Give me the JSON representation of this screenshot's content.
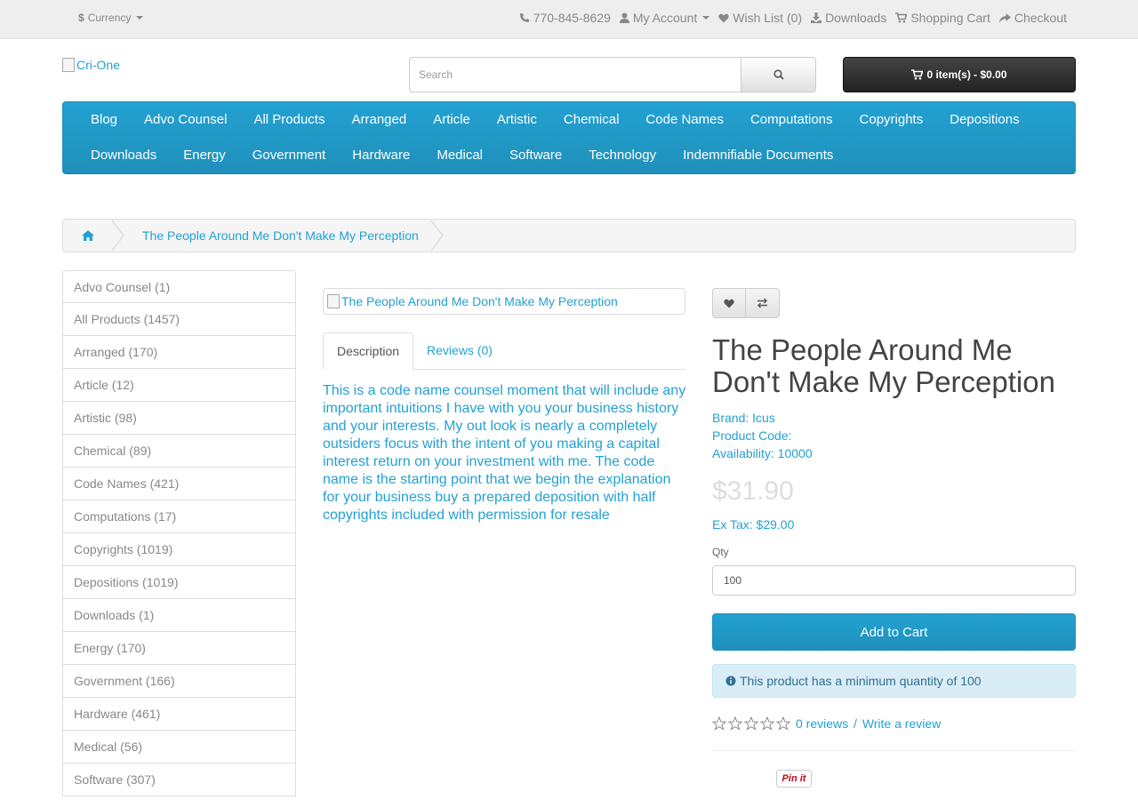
{
  "topbar": {
    "currency": "Currency",
    "phone": "770-845-8629",
    "my_account": "My Account",
    "wish_list": "Wish List (0)",
    "downloads": "Downloads",
    "shopping_cart": "Shopping Cart",
    "checkout": "Checkout"
  },
  "header": {
    "logo_alt": "Cri-One",
    "search_placeholder": "Search",
    "cart_label": "0 item(s) - $0.00"
  },
  "menu": {
    "items": [
      "Blog",
      "Advo Counsel",
      "All Products",
      "Arranged",
      "Article",
      "Artistic",
      "Chemical",
      "Code Names",
      "Computations",
      "Copyrights",
      "Depositions",
      "Downloads",
      "Energy",
      "Government",
      "Hardware",
      "Medical",
      "Software",
      "Technology",
      "Indemnifiable Documents"
    ]
  },
  "breadcrumb": {
    "current": "The People Around Me Don't Make My Perception"
  },
  "sidebar": {
    "items": [
      "Advo Counsel (1)",
      "All Products (1457)",
      "Arranged (170)",
      "Article (12)",
      "Artistic (98)",
      "Chemical (89)",
      "Code Names (421)",
      "Computations (17)",
      "Copyrights (1019)",
      "Depositions (1019)",
      "Downloads (1)",
      "Energy (170)",
      "Government (166)",
      "Hardware (461)",
      "Medical (56)",
      "Software (307)"
    ]
  },
  "product": {
    "image_alt": "The People Around Me Don't Make My Perception",
    "tab_description": "Description",
    "tab_reviews": "Reviews (0)",
    "description": "This is a code name counsel moment that will include any important intuitions I have with you your business history and your interests. My out look is nearly a completely outsiders focus with the intent of you making a capital interest return on your investment with me. The code name is the starting point that we begin the explanation for your business buy a prepared deposition with half copyrights included with permission for resale",
    "title": "The People Around Me Don't Make My Perception",
    "brand_label": "Brand:",
    "brand": "Icus",
    "product_code_label": "Product Code:",
    "availability_label": "Availability:",
    "availability": "10000",
    "price": "$31.90",
    "ex_tax": "Ex Tax: $29.00",
    "qty_label": "Qty",
    "qty_value": "100",
    "add_to_cart": "Add to Cart",
    "min_qty_alert": "This product has a minimum quantity of 100",
    "reviews_link": "0 reviews",
    "review_sep": " / ",
    "write_review": "Write a review",
    "rating_stars": 0,
    "pinit": "Pin it"
  },
  "colors": {
    "accent": "#23a1d1",
    "price": "#dddddd",
    "alert_bg": "#d9edf7"
  }
}
